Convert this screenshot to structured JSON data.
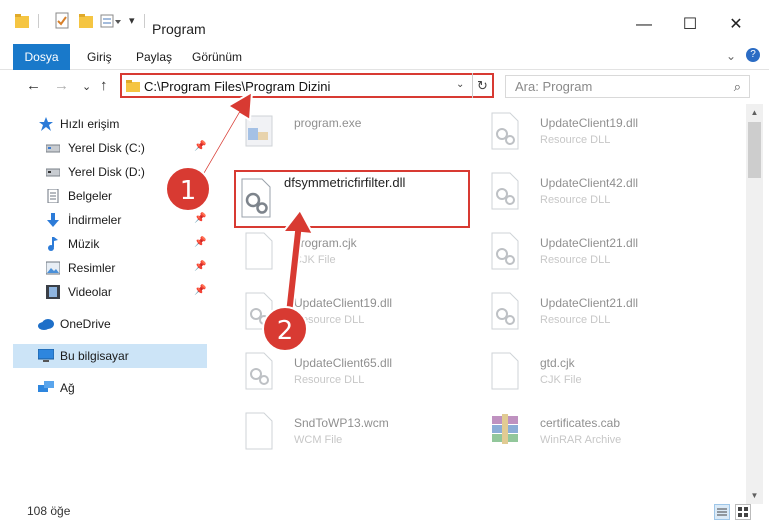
{
  "window": {
    "title": "Program",
    "minimize_glyph": "—",
    "maximize_glyph": "☐",
    "close_glyph": "✕"
  },
  "ribbon": {
    "tabs": [
      "Dosya",
      "Giriş",
      "Paylaş",
      "Görünüm"
    ],
    "expand_glyph": "⌄",
    "help_glyph": "?"
  },
  "nav": {
    "back_glyph": "←",
    "forward_glyph": "→",
    "recent_glyph": "⌄",
    "up_glyph": "↑"
  },
  "address": {
    "path": "C:\\Program Files\\Program Dizini",
    "dropdown_glyph": "⌄",
    "refresh_glyph": "↻"
  },
  "search": {
    "placeholder": "Ara: Program",
    "icon": "search-icon",
    "icon_glyph": "⌕"
  },
  "sidebar": {
    "items": [
      {
        "label": "Hızlı erişim",
        "icon": "star-icon",
        "pinned": false
      },
      {
        "label": "Yerel Disk (C:)",
        "icon": "drive-icon",
        "pinned": true
      },
      {
        "label": "Yerel Disk (D:)",
        "icon": "drive-icon",
        "pinned": false
      },
      {
        "label": "Belgeler",
        "icon": "documents-icon",
        "pinned": true
      },
      {
        "label": "İndirmeler",
        "icon": "download-icon",
        "pinned": true
      },
      {
        "label": "Müzik",
        "icon": "music-icon",
        "pinned": true
      },
      {
        "label": "Resimler",
        "icon": "pictures-icon",
        "pinned": true
      },
      {
        "label": "Videolar",
        "icon": "video-icon",
        "pinned": true
      },
      {
        "label": "OneDrive",
        "icon": "cloud-icon",
        "pinned": false
      },
      {
        "label": "Bu bilgisayar",
        "icon": "computer-icon",
        "pinned": false,
        "selected": true
      },
      {
        "label": "Ağ",
        "icon": "network-icon",
        "pinned": false
      }
    ]
  },
  "files": [
    {
      "name": "program.exe",
      "type": ""
    },
    {
      "name": "UpdateClient19.dll",
      "type": "Resource DLL"
    },
    {
      "name": "dfsymmetricfirfilter.dll",
      "type": ""
    },
    {
      "name": "UpdateClient42.dll",
      "type": "Resource DLL"
    },
    {
      "name": "program.cjk",
      "type": "CJK File"
    },
    {
      "name": "UpdateClient21.dll",
      "type": "Resource DLL"
    },
    {
      "name": "UpdateClient19.dll",
      "type": "Resource DLL"
    },
    {
      "name": "UpdateClient21.dll",
      "type": "Resource DLL"
    },
    {
      "name": "UpdateClient65.dll",
      "type": "Resource DLL"
    },
    {
      "name": "gtd.cjk",
      "type": "CJK File"
    },
    {
      "name": "SndToWP13.wcm",
      "type": "WCM File"
    },
    {
      "name": "certificates.cab",
      "type": "WinRAR Archive"
    }
  ],
  "highlighted_file": "dfsymmetricfirfilter.dll",
  "annotations": [
    "1",
    "2"
  ],
  "status": {
    "item_count": "108 öğe"
  },
  "colors": {
    "accent": "#1979ca",
    "annotation_red": "#d83a32",
    "selection": "#cce4f7"
  }
}
